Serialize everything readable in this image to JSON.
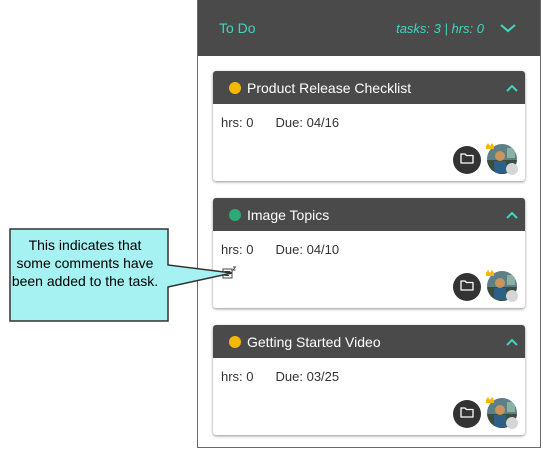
{
  "panel": {
    "title": "To Do",
    "summary": "tasks: 3 | hrs: 0"
  },
  "tasks": [
    {
      "title": "Product Release Checklist",
      "hrs": "hrs: 0",
      "due": "Due: 04/16",
      "status_color": "#f5b800",
      "has_comments": false
    },
    {
      "title": "Image Topics",
      "hrs": "hrs: 0",
      "due": "Due: 04/10",
      "status_color": "#2eaa78",
      "has_comments": true
    },
    {
      "title": "Getting Started Video",
      "hrs": "hrs: 0",
      "due": "Due: 03/25",
      "status_color": "#f5b800",
      "has_comments": false
    }
  ],
  "callout": {
    "text": "This indicates that some comments have been added to the task."
  },
  "colors": {
    "accent": "#3fd6c0",
    "header_bg": "#4a4a4a",
    "callout_bg": "#a6f2f2"
  }
}
